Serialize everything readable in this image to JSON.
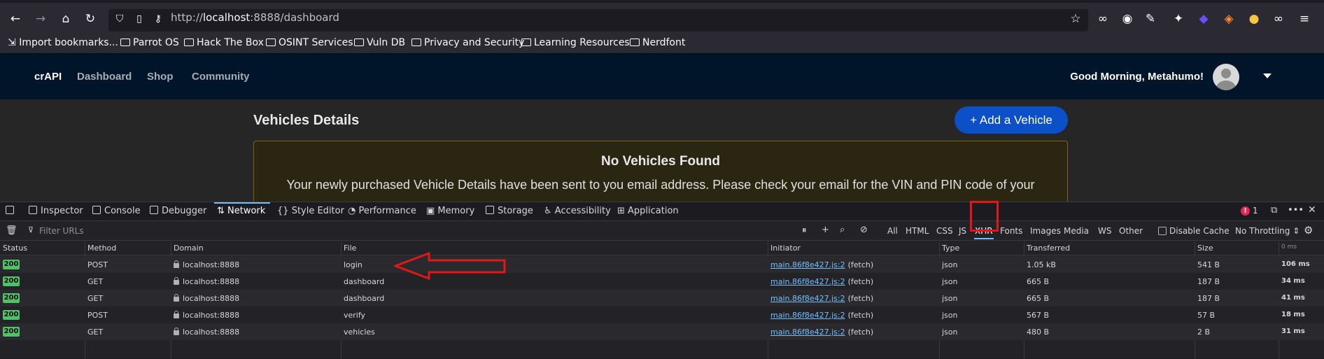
{
  "browser": {
    "url_prefix": "http://",
    "url_host": "localhost",
    "url_rest": ":8888/dashboard",
    "bookmarks": [
      "Import bookmarks...",
      "Parrot OS",
      "Hack The Box",
      "OSINT Services",
      "Vuln DB",
      "Privacy and Security",
      "Learning Resources",
      "Nerdfont"
    ]
  },
  "app": {
    "brand": "crAPI",
    "nav": [
      "Dashboard",
      "Shop",
      "Community"
    ],
    "greeting": "Good Morning, Metahumo!",
    "section_title": "Vehicles Details",
    "add_button": "Add a Vehicle",
    "alert_title": "No Vehicles Found",
    "alert_message": "Your newly purchased Vehicle Details have been sent to you email address. Please check your email for the VIN and PIN code of your"
  },
  "devtools": {
    "tabs": [
      "Inspector",
      "Console",
      "Debugger",
      "Network",
      "Style Editor",
      "Performance",
      "Memory",
      "Storage",
      "Accessibility",
      "Application"
    ],
    "active_tab": "Network",
    "error_count": "1",
    "filter_placeholder": "Filter URLs",
    "type_filters": [
      "All",
      "HTML",
      "CSS",
      "JS",
      "XHR",
      "Fonts",
      "Images",
      "Media",
      "WS",
      "Other"
    ],
    "active_filter": "XHR",
    "disable_cache": "Disable Cache",
    "throttling": "No Throttling ⇕",
    "columns": [
      "Status",
      "Method",
      "Domain",
      "File",
      "Initiator",
      "Type",
      "Transferred",
      "Size",
      "0 ms"
    ],
    "rows": [
      {
        "status": "200",
        "method": "POST",
        "domain": "localhost:8888",
        "file": "login",
        "initiator": "main.86f8e427.js:2",
        "initiator_suffix": "(fetch)",
        "type": "json",
        "transferred": "1.05 kB",
        "size": "541 B",
        "time": "106 ms"
      },
      {
        "status": "200",
        "method": "GET",
        "domain": "localhost:8888",
        "file": "dashboard",
        "initiator": "main.86f8e427.js:2",
        "initiator_suffix": "(fetch)",
        "type": "json",
        "transferred": "665 B",
        "size": "187 B",
        "time": "34 ms"
      },
      {
        "status": "200",
        "method": "GET",
        "domain": "localhost:8888",
        "file": "dashboard",
        "initiator": "main.86f8e427.js:2",
        "initiator_suffix": "(fetch)",
        "type": "json",
        "transferred": "665 B",
        "size": "187 B",
        "time": "41 ms"
      },
      {
        "status": "200",
        "method": "POST",
        "domain": "localhost:8888",
        "file": "verify",
        "initiator": "main.86f8e427.js:2",
        "initiator_suffix": "(fetch)",
        "type": "json",
        "transferred": "567 B",
        "size": "57 B",
        "time": "18 ms"
      },
      {
        "status": "200",
        "method": "GET",
        "domain": "localhost:8888",
        "file": "vehicles",
        "initiator": "main.86f8e427.js:2",
        "initiator_suffix": "(fetch)",
        "type": "json",
        "transferred": "480 B",
        "size": "2 B",
        "time": "31 ms"
      }
    ]
  },
  "annotations": {
    "highlight_color": "#e01818"
  }
}
